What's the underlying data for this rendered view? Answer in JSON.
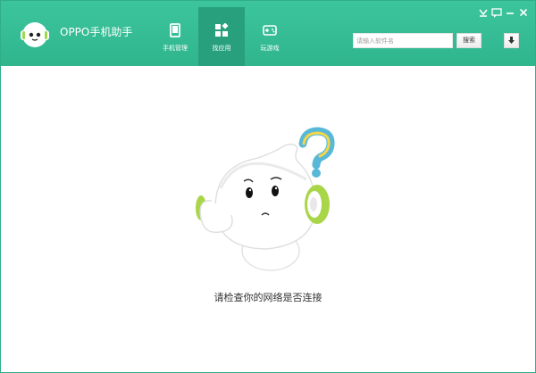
{
  "window": {
    "title": "OPPO手机助手",
    "accent_color": "#34b990",
    "controls": [
      "skin-icon",
      "feedback-icon",
      "minimize-icon",
      "close-icon"
    ]
  },
  "nav": {
    "tabs": [
      {
        "label": "手机管理",
        "icon": "phone-icon",
        "active": false
      },
      {
        "label": "找应用",
        "icon": "apps-grid-icon",
        "active": true
      },
      {
        "label": "玩游戏",
        "icon": "gamepad-icon",
        "active": false
      }
    ]
  },
  "search": {
    "placeholder": "请输入软件名",
    "value": "",
    "button_label": "搜索"
  },
  "download": {
    "icon": "download-arrow-icon"
  },
  "main": {
    "illustration": "confused-mascot-icon",
    "message": "请检查你的网络是否连接"
  }
}
